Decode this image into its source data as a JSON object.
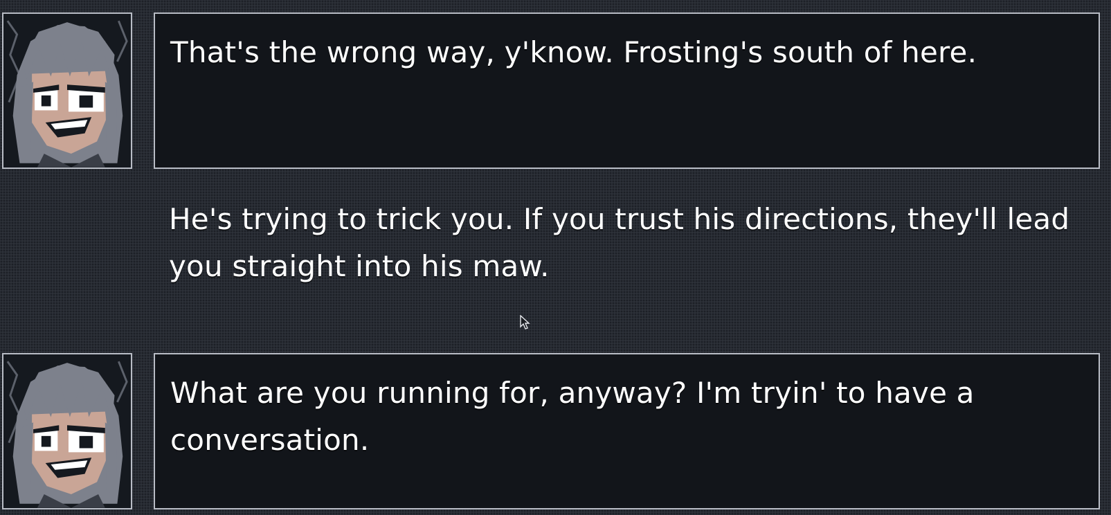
{
  "dialogue": [
    {
      "speaker_portrait": "grinning-gray-haired-character-portrait",
      "text": "That's the wrong way, y'know. Frosting's south of here."
    },
    {
      "speaker_portrait": "grinning-gray-haired-character-portrait",
      "text": "What are you running for, anyway? I'm tryin' to have a conversation."
    }
  ],
  "narration": {
    "text": "He's trying to trick you. If you trust his directions, they'll lead you straight into his maw."
  },
  "colors": {
    "background": "#272b33",
    "box_fill": "#12151a",
    "box_border": "#b9bdc6",
    "text": "#ffffff",
    "skin": "#c9a596",
    "hair": "#7d818c"
  },
  "icons": {
    "cursor": "mouse-pointer-icon"
  }
}
